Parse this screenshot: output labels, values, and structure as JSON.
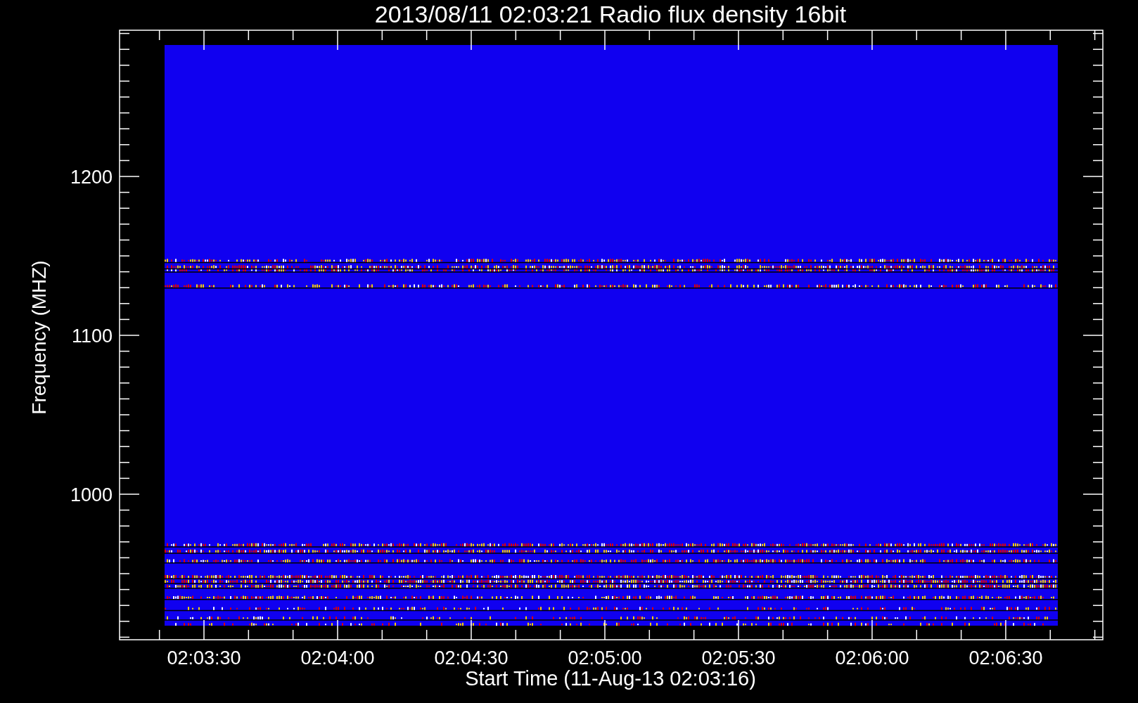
{
  "title": "2013/08/11 02:03:21 Radio flux density 16bit",
  "y_axis": {
    "label": "Frequency (MHZ)",
    "ticks": [
      "1200",
      "1100",
      "1000"
    ]
  },
  "x_axis": {
    "label": "Start Time (11-Aug-13 02:03:16)",
    "ticks": [
      "02:03:30",
      "02:04:00",
      "02:04:30",
      "02:05:00",
      "02:05:30",
      "02:06:00",
      "02:06:30"
    ]
  }
}
